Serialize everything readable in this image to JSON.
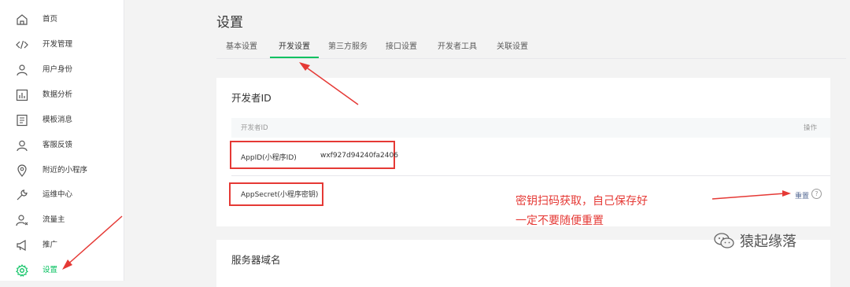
{
  "sidebar": {
    "items": [
      {
        "label": "首页",
        "icon": "home-icon"
      },
      {
        "label": "开发管理",
        "icon": "code-icon"
      },
      {
        "label": "用户身份",
        "icon": "user-icon"
      },
      {
        "label": "数据分析",
        "icon": "chart-icon"
      },
      {
        "label": "模板消息",
        "icon": "template-icon"
      },
      {
        "label": "客服反馈",
        "icon": "support-icon"
      },
      {
        "label": "附近的小程序",
        "icon": "location-icon"
      },
      {
        "label": "运维中心",
        "icon": "wrench-icon"
      },
      {
        "label": "流量主",
        "icon": "traffic-icon"
      },
      {
        "label": "推广",
        "icon": "megaphone-icon"
      },
      {
        "label": "设置",
        "icon": "gear-icon",
        "active": true
      }
    ]
  },
  "page": {
    "title": "设置",
    "tabs": [
      "基本设置",
      "开发设置",
      "第三方服务",
      "接口设置",
      "开发者工具",
      "关联设置"
    ],
    "active_tab": "开发设置"
  },
  "dev_card": {
    "title": "开发者ID",
    "header_col1": "开发者ID",
    "header_col2": "操作",
    "appid_label": "AppID(小程序ID)",
    "appid_value": "wxf927d94240fa2406",
    "appsecret_label": "AppSecret(小程序密钥)",
    "reset_label": "重置",
    "help_label": "?"
  },
  "server_card": {
    "title": "服务器域名"
  },
  "annotation": {
    "line1": "密钥扫码获取，自己保存好",
    "line2": "一定不要随便重置"
  },
  "watermark": {
    "text": "猿起缘落"
  },
  "colors": {
    "accent": "#07c160",
    "annotation": "#e53935",
    "link": "#576b95"
  }
}
